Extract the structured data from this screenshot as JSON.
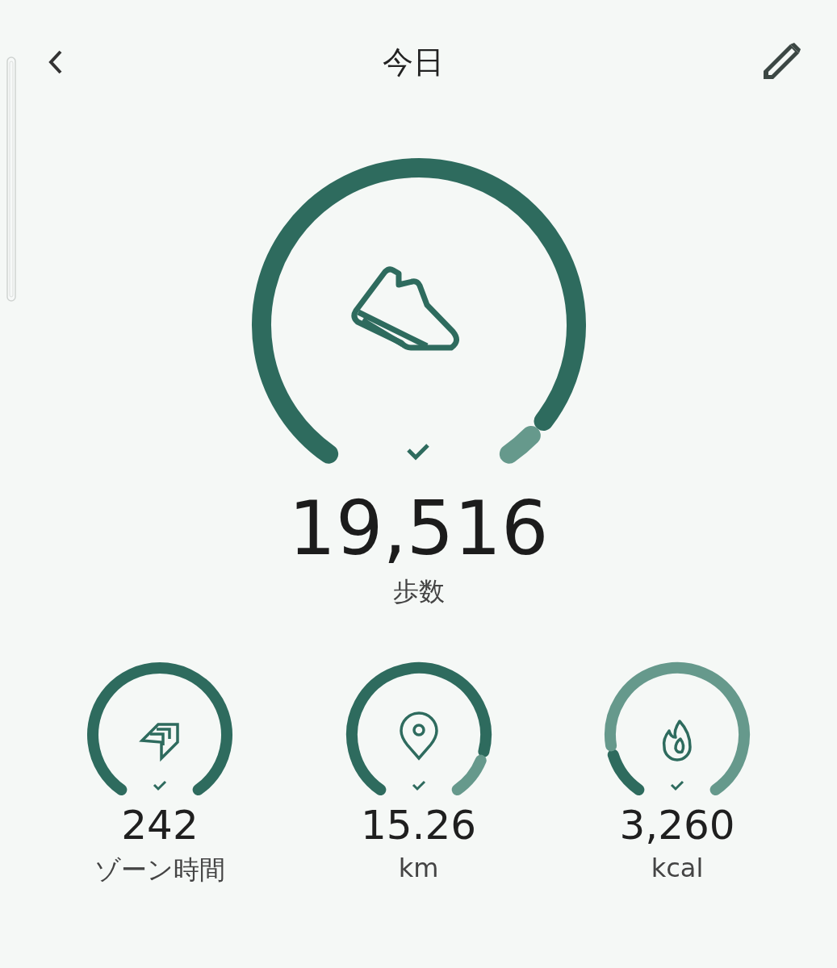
{
  "header": {
    "title": "今日"
  },
  "main": {
    "kind": "steps",
    "value": "19,516",
    "label": "歩数",
    "goal_met": true
  },
  "metrics": [
    {
      "kind": "zone",
      "value": "242",
      "label": "ゾーン時間",
      "goal_met": true
    },
    {
      "kind": "distance",
      "value": "15.26",
      "label": "km",
      "goal_met": true
    },
    {
      "kind": "calories",
      "value": "3,260",
      "label": "kcal",
      "goal_met": true
    }
  ]
}
